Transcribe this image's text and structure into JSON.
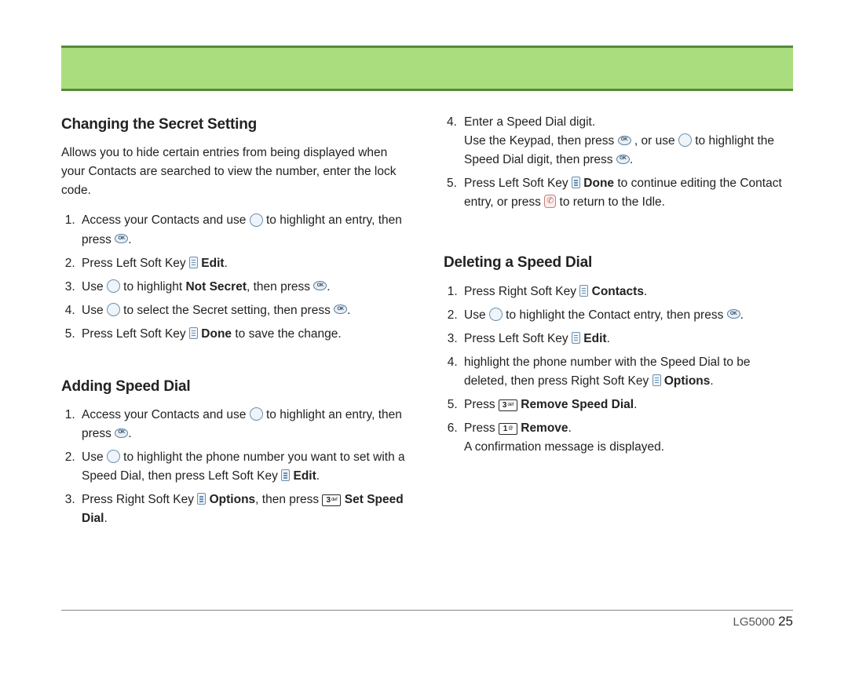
{
  "footer": {
    "model": "LG5000",
    "page": "25"
  },
  "left": {
    "section1": {
      "heading": "Changing the Secret Setting",
      "intro": "Allows you to hide certain entries from being displayed when your Contacts are searched to view the number, enter the lock code.",
      "step1a": "Access your Contacts and use ",
      "step1b": " to highlight an entry, then press ",
      "step2a": "Press Left Soft Key ",
      "step2b": " Edit",
      "step3a": "Use ",
      "step3b": " to highlight ",
      "step3c": "Not Secret",
      "step3d": ", then press ",
      "step4a": "Use ",
      "step4b": " to select the Secret setting, then press ",
      "step5a": "Press Left Soft Key ",
      "step5b": " Done",
      "step5c": " to save the change."
    },
    "section2": {
      "heading": "Adding Speed Dial",
      "step1a": "Access your Contacts and use ",
      "step1b": " to highlight an entry, then press ",
      "step2a": "Use ",
      "step2b": " to highlight the phone number you want to set with a Speed Dial, then press  Left Soft Key ",
      "step2c": " Edit",
      "step3a": "Press Right Soft Key ",
      "step3b": " Options",
      "step3c": ", then press ",
      "step3d": " Set Speed Dial"
    }
  },
  "right": {
    "cont": {
      "step4a": "Enter a Speed Dial digit.",
      "step4b": "Use the Keypad, then press ",
      "step4c": " , or use ",
      "step4d": " to highlight the Speed Dial digit, then press ",
      "step5a": "Press Left Soft Key ",
      "step5b": " Done",
      "step5c": " to continue editing the Contact entry, or press ",
      "step5d": " to return to the Idle."
    },
    "section3": {
      "heading": "Deleting a Speed Dial",
      "step1a": "Press Right Soft Key ",
      "step1b": " Contacts",
      "step2a": "Use ",
      "step2b": " to highlight the Contact entry, then press ",
      "step3a": "Press Left Soft Key ",
      "step3b": " Edit",
      "step4a": "highlight the phone number with the Speed Dial to be deleted, then press Right Soft Key ",
      "step4b": " Options",
      "step5a": "Press ",
      "step5b": " Remove Speed Dial",
      "step6a": "Press ",
      "step6b": " Remove",
      "step6c": "A confirmation message is displayed."
    }
  },
  "keys": {
    "key3": {
      "digit": "3",
      "sub": "def"
    },
    "key1": {
      "digit": "1",
      "sub": "@"
    }
  }
}
